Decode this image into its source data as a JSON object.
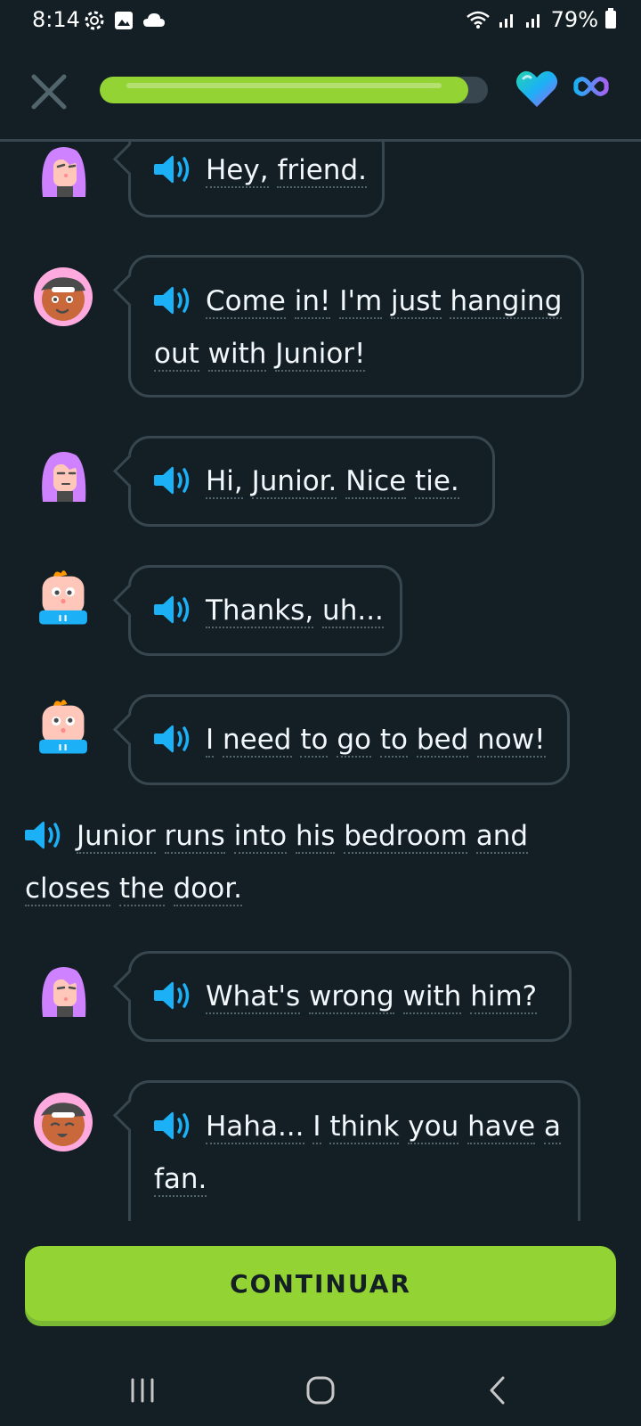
{
  "status_bar": {
    "time": "8:14",
    "battery": "79%"
  },
  "header": {
    "progress_fraction": 0.95
  },
  "messages": [
    {
      "speaker": "purple-hair-character",
      "lines": [
        [
          "Hey,",
          "friend."
        ]
      ]
    },
    {
      "speaker": "pink-avatar-character",
      "lines": [
        [
          "Come",
          "in!",
          "I'm",
          "just",
          "hanging"
        ],
        [
          "out",
          "with",
          "Junior!"
        ]
      ]
    },
    {
      "speaker": "purple-hair-character",
      "lines": [
        [
          "Hi,",
          "Junior.",
          "Nice",
          "tie."
        ]
      ]
    },
    {
      "speaker": "junior-character",
      "lines": [
        [
          "Thanks,",
          "uh..."
        ]
      ]
    },
    {
      "speaker": "junior-character",
      "lines": [
        [
          "I",
          "need",
          "to",
          "go",
          "to",
          "bed",
          "now!"
        ]
      ]
    }
  ],
  "narration": {
    "lines": [
      [
        "Junior",
        "runs",
        "into",
        "his",
        "bedroom",
        "and"
      ],
      [
        "closes",
        "the",
        "door."
      ]
    ]
  },
  "messages2": [
    {
      "speaker": "purple-hair-character",
      "lines": [
        [
          "What's",
          "wrong",
          "with",
          "him?"
        ]
      ]
    },
    {
      "speaker": "pink-avatar-character",
      "lines": [
        [
          "Haha...",
          "I",
          "think",
          "you",
          "have",
          "a"
        ],
        [
          "fan."
        ]
      ]
    }
  ],
  "continue_label": "CONTINUAR",
  "colors": {
    "accent": "#93d333",
    "background": "#131f24",
    "speaker": "#1cb0f6",
    "border": "#37464f"
  }
}
